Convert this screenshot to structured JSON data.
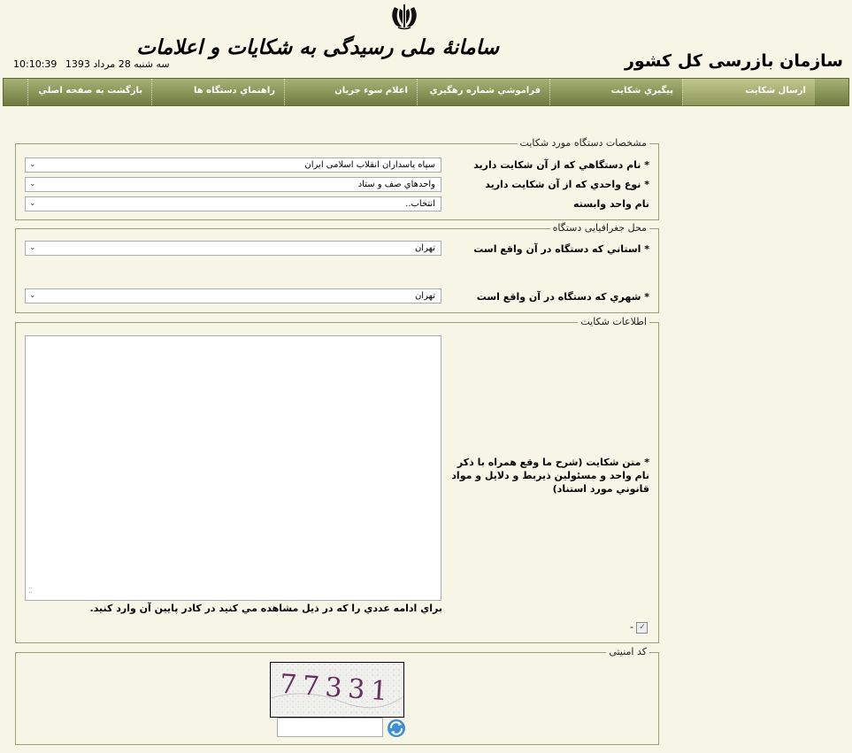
{
  "header": {
    "site_title": "سامانهٔ ملی رسیدگی به شکایات و اعلامات",
    "org_name": "سازمان بازرسی کل کشور",
    "date": "سه شنبه 28 مرداد 1393",
    "time": "10:10:39"
  },
  "nav": {
    "items": [
      {
        "label": "ارسال شكايت"
      },
      {
        "label": "پيگيري شكايت"
      },
      {
        "label": "فراموشي شماره رهگيري"
      },
      {
        "label": "اعلام سوء جريان"
      },
      {
        "label": "راهنماي دستگاه ها"
      },
      {
        "label": "بازگشت به صفحه اصلي"
      }
    ]
  },
  "agency": {
    "legend": "مشخصات دستگاه مورد شکایت",
    "agency_label": "* نام دستگاهي كه از آن شكايت داريد",
    "agency_value": "سپاه پاسداران انقلاب اسلامی ایران",
    "unit_type_label": "* نوع واحدي كه از آن شكايت داريد",
    "unit_type_value": "واحدهاي صف و ستاد",
    "unit_name_label": "نام واحد وابسته",
    "unit_name_value": "انتخاب.."
  },
  "location": {
    "legend": "محل جغرافیایی دستگاه",
    "province_label": "* استاني كه دستگاه در آن واقع است",
    "province_value": "تهران",
    "city_label": "* شهري كه دستگاه در آن واقع است",
    "city_value": "تهران"
  },
  "complaint": {
    "legend": "اطلاعات شکایت",
    "text_label": "* متن شكايت (شرح ما وقع همراه با ذكر نام واحد و مسئولين ذيربط و دلايل و مواد قانوني مورد استناد)",
    "text_value": "",
    "captcha_note": "براي ادامه عددي را كه در ذيل مشاهده مي كنيد در كادر پايين آن وارد كنيد.",
    "checkbox_label": "-"
  },
  "security": {
    "legend": "کد امنیتی",
    "captcha_text": "77331",
    "input_value": ""
  },
  "colors": {
    "background": "#f6f5e6",
    "nav_bar": "#7f8a4c",
    "captcha_ink": "#6a2f62"
  },
  "icons": {
    "emblem": "iran-emblem-icon",
    "refresh": "refresh-icon",
    "dropdown": "chevron-down-icon"
  }
}
